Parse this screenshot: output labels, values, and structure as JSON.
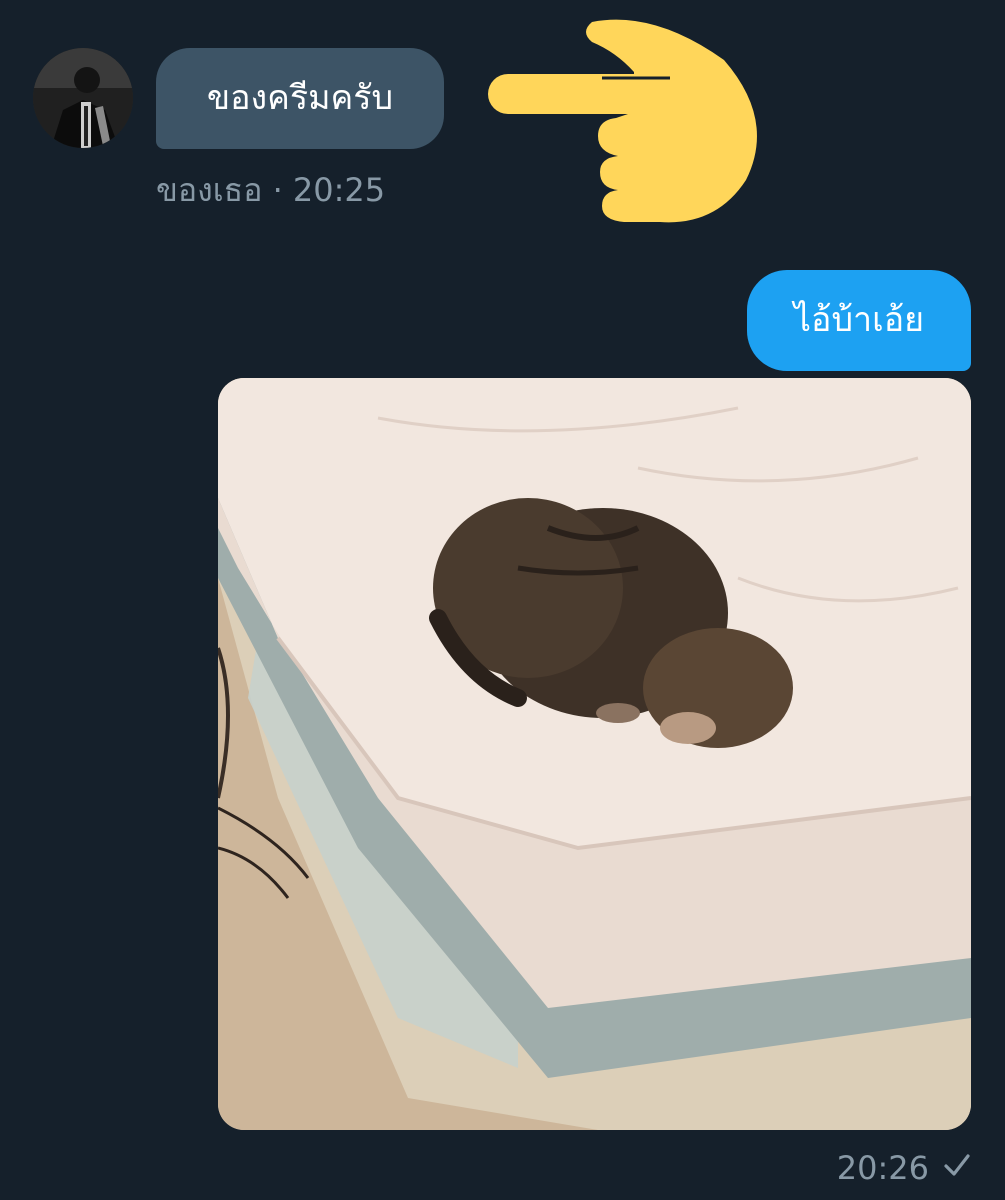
{
  "conversation": {
    "incoming": {
      "text": "ของครีมครับ",
      "sender": "ของเธอ",
      "separator": "·",
      "time": "20:25"
    },
    "outgoing": {
      "text": "ไอ้บ้าเอ้ย",
      "time": "20:26",
      "status_icon": "checkmark-icon"
    }
  },
  "colors": {
    "background": "#15202b",
    "incoming_bubble": "#3d5466",
    "outgoing_bubble": "#1da1f2",
    "meta_text": "#8899a6",
    "pointer_emoji": "#ffd65a"
  },
  "icons": {
    "pointer": "pointing-hand-icon",
    "avatar": "avatar"
  }
}
